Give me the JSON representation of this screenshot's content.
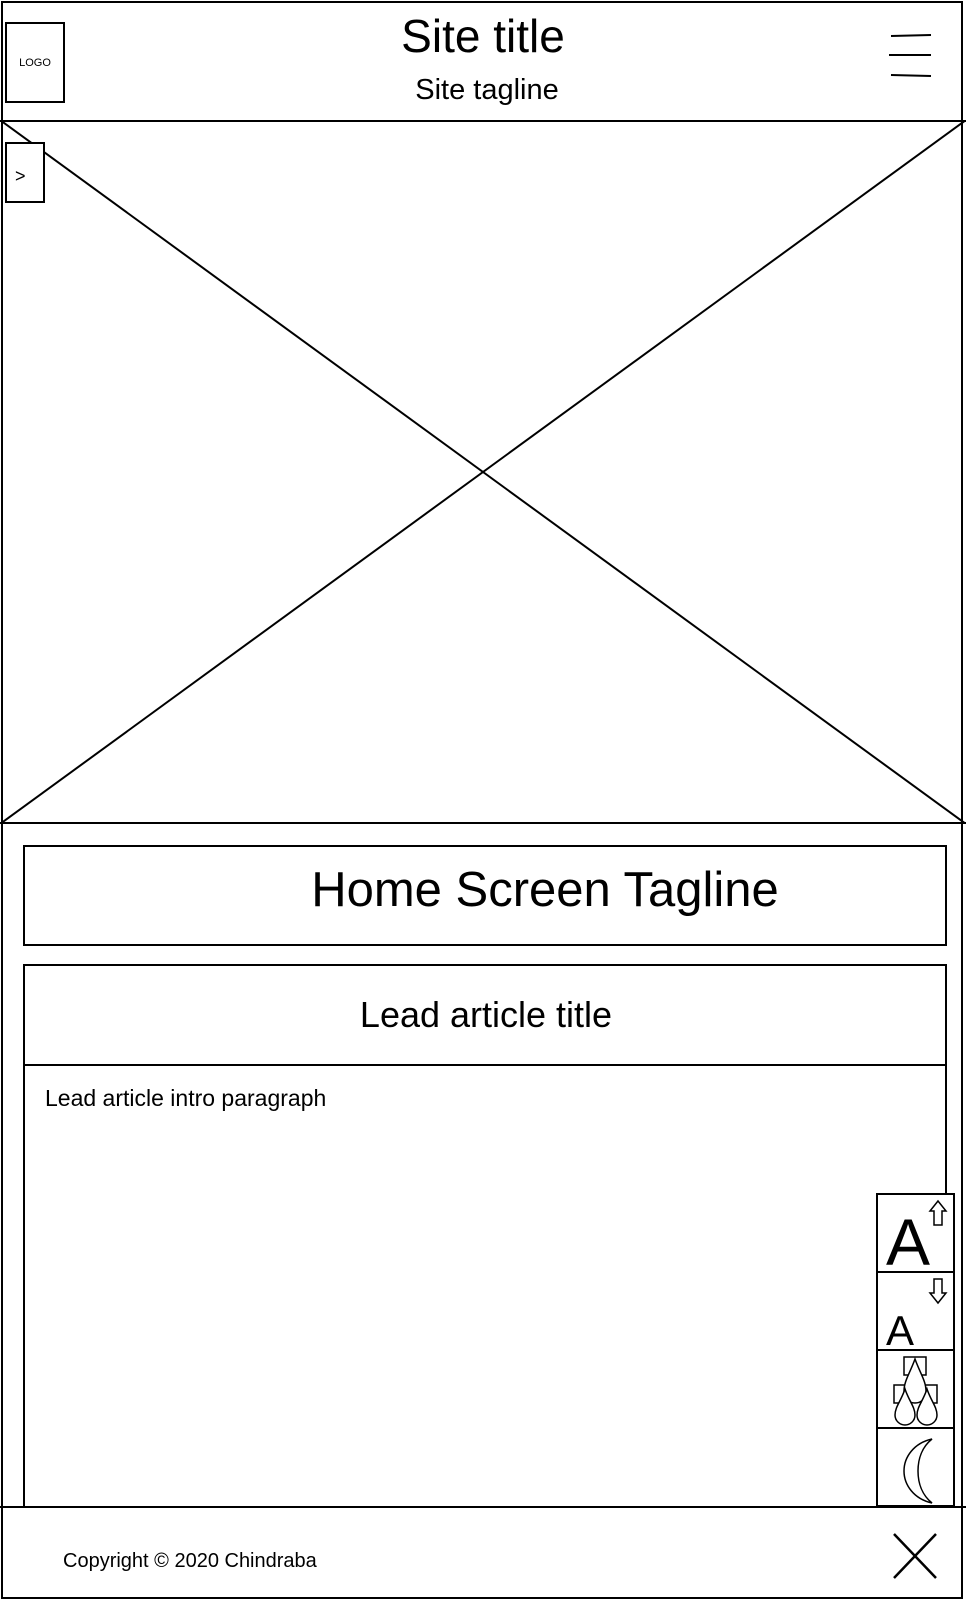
{
  "header": {
    "logo_label": "LOGO",
    "site_title": "Site title",
    "site_tagline": "Site tagline",
    "menu_icon": "hamburger-menu-icon"
  },
  "hero": {
    "image_icon": "image-placeholder",
    "next_label": ">"
  },
  "main": {
    "home_tagline": "Home Screen Tagline",
    "lead_article": {
      "title": "Lead article title",
      "intro": "Lead article intro paragraph"
    }
  },
  "a11y_toolbar": {
    "buttons": [
      {
        "icon": "font-increase-icon",
        "glyph": "A"
      },
      {
        "icon": "font-decrease-icon",
        "glyph": "A"
      },
      {
        "icon": "contrast-drops-icon"
      },
      {
        "icon": "moon-icon"
      }
    ]
  },
  "footer": {
    "copyright": "Copyright © 2020 Chindraba",
    "close_icon": "close-icon"
  }
}
